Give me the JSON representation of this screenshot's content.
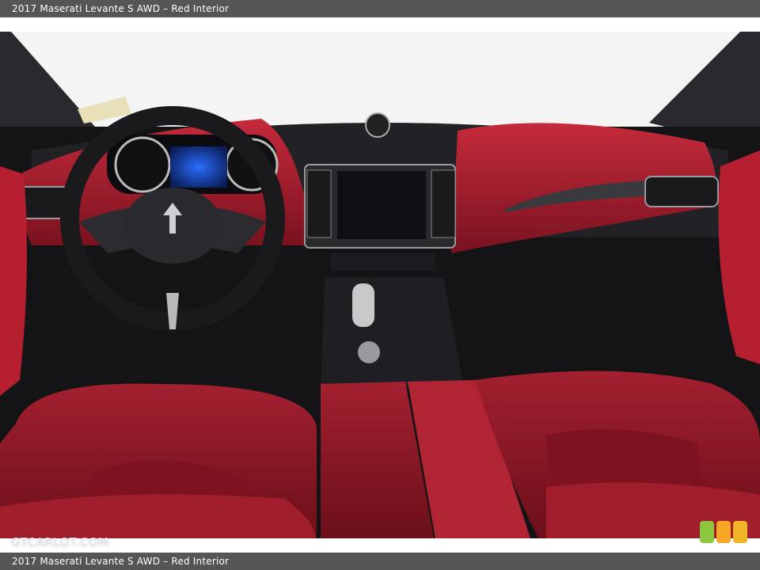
{
  "caption": {
    "top": "2017 Maserati Levante S AWD – Red Interior",
    "bottom": "2017 Maserati Levante S AWD – Red Interior"
  },
  "watermark": "GTCARLOT.COM",
  "image": {
    "subject": "car interior dashboard",
    "colors": {
      "leather": "#a11c2a",
      "leather_dark": "#6e0f1a",
      "trim": "#1b1b1e",
      "windshield": "#f4f4f4"
    }
  },
  "logo_badge": {
    "colors": [
      "#8cc63f",
      "#f5a623",
      "#f0b429"
    ]
  }
}
